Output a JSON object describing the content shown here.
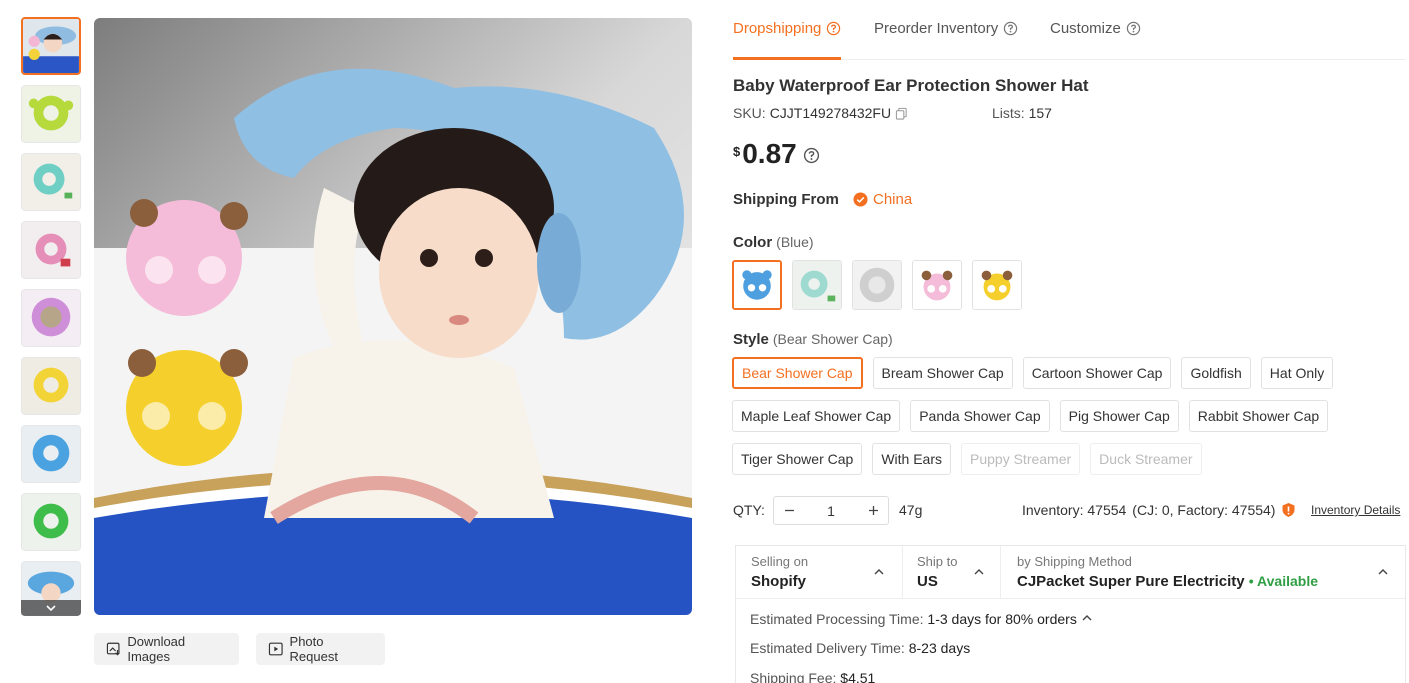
{
  "tabs": [
    {
      "label": "Dropshipping"
    },
    {
      "label": "Preorder Inventory"
    },
    {
      "label": "Customize"
    }
  ],
  "product": {
    "title": "Baby Waterproof Ear Protection Shower Hat",
    "sku_label": "SKU:",
    "sku": "CJJT149278432FU",
    "lists_label": "Lists:",
    "lists": "157",
    "currency": "$",
    "price": "0.87"
  },
  "shipping_from": {
    "label": "Shipping From",
    "country": "China"
  },
  "color": {
    "label": "Color",
    "selected": "(Blue)"
  },
  "style": {
    "label": "Style",
    "selected": "(Bear Shower Cap)",
    "options_row1": [
      "Bear Shower Cap",
      "Bream Shower Cap",
      "Cartoon Shower Cap",
      "Goldfish",
      "Hat Only"
    ],
    "options_row2": [
      "Maple Leaf Shower Cap",
      "Panda Shower Cap",
      "Pig Shower Cap",
      "Rabbit Shower Cap"
    ],
    "options_row3": [
      "Tiger Shower Cap",
      "With Ears",
      "Puppy Streamer",
      "Duck Streamer"
    ]
  },
  "quantity": {
    "label": "QTY:",
    "value": "1",
    "weight": "47g",
    "inventory": "Inventory: 47554",
    "inventory_detail": "(CJ: 0, Factory: 47554)",
    "inventory_link": "Inventory Details"
  },
  "shipping": {
    "selling_on_label": "Selling on",
    "selling_on": "Shopify",
    "ship_to_label": "Ship to",
    "ship_to": "US",
    "method_label": "by Shipping Method",
    "method": "CJPacket Super Pure Electricity",
    "availability": "• Available",
    "processing_label": "Estimated Processing Time:",
    "processing": "1-3 days for 80% orders",
    "delivery_label": "Estimated Delivery Time:",
    "delivery": "8-23 days",
    "fee_label": "Shipping Fee:",
    "fee": "$4.51"
  },
  "image_actions": {
    "download": "Download Images",
    "photo_request": "Photo Request"
  },
  "colors": {
    "accent": "#f37021",
    "available": "#2f9e44"
  }
}
